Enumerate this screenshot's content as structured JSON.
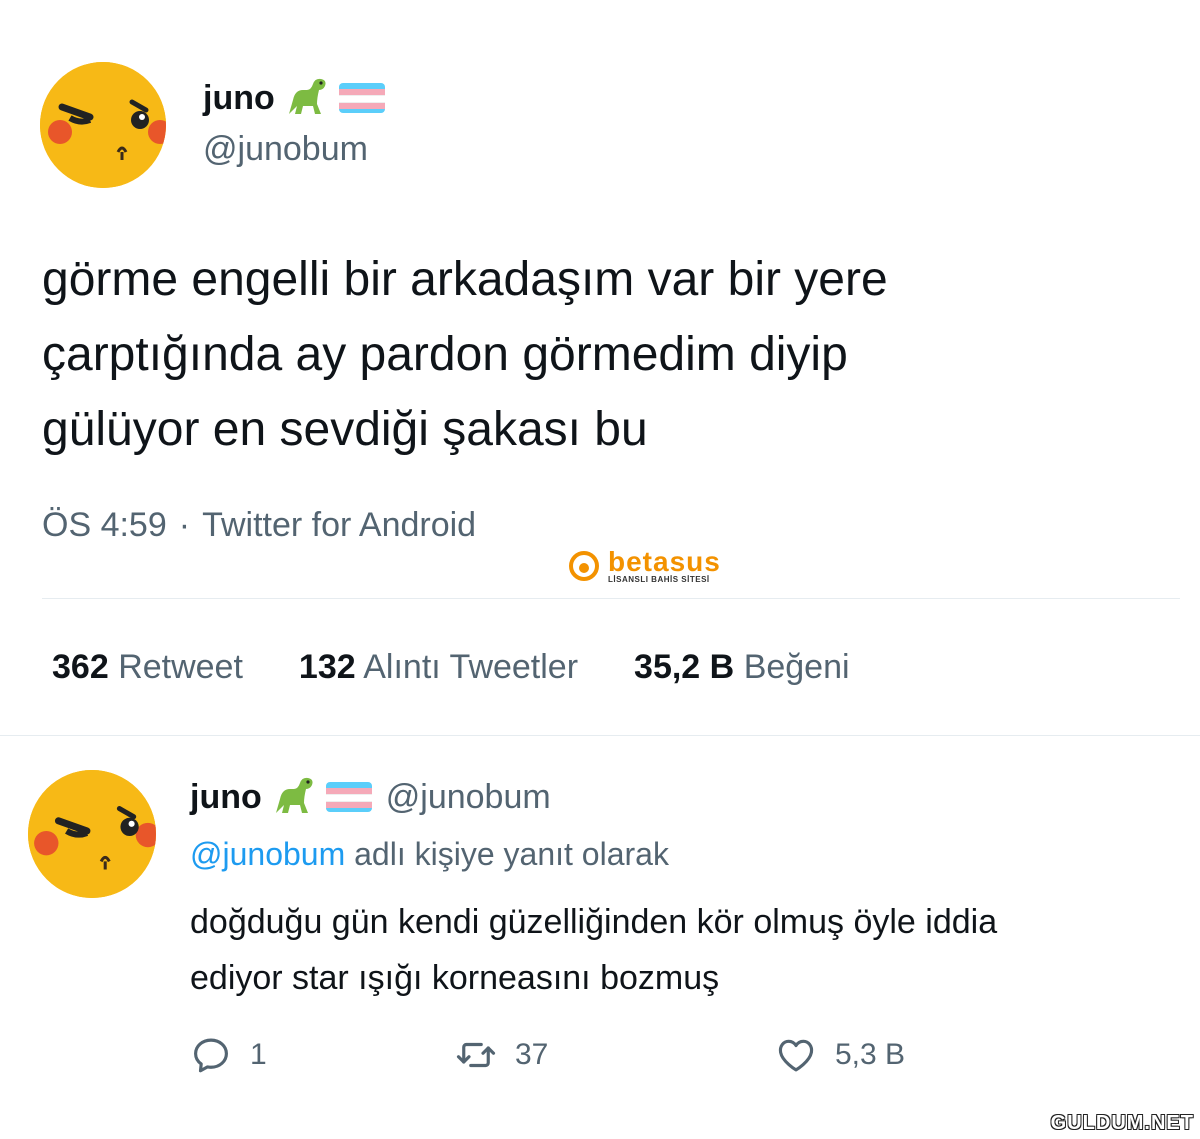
{
  "main_tweet": {
    "display_name": "juno",
    "handle": "@junobum",
    "text_lines": [
      "görme engelli bir arkadaşım var bir yere",
      "çarptığında ay pardon görmedim diyip",
      "gülüyor en sevdiği şakası bu"
    ],
    "time": "ÖS 4:59",
    "separator": "·",
    "source": "Twitter for Android",
    "stats": {
      "retweets_count": "362",
      "retweets_label": "Retweet",
      "quotes_count": "132",
      "quotes_label": "Alıntı Tweetler",
      "likes_count": "35,2 B",
      "likes_label": "Beğeni"
    }
  },
  "reply": {
    "display_name": "juno",
    "handle": "@junobum",
    "reply_to_handle": "@junobum",
    "reply_to_suffix": "adlı kişiye yanıt olarak",
    "text_lines": [
      "doğduğu gün kendi güzelliğinden kör olmuş öyle iddia",
      "ediyor star ışığı korneasını bozmuş"
    ],
    "actions": {
      "reply_count": "1",
      "retweet_count": "37",
      "like_count": "5,3 B"
    }
  },
  "watermarks": {
    "brand_top": "betasus",
    "brand_sub": "LİSANSLI BAHİS SİTESİ",
    "corner": "GULDUM.NET"
  },
  "colors": {
    "text": "#0f1419",
    "muted": "#536471",
    "link": "#1d9bf0",
    "avatar": "#f7b916",
    "flag_blue": "#5bcefa",
    "flag_pink": "#f5a9b8",
    "brand_orange": "#f39200"
  },
  "icons": [
    "dinosaur-icon",
    "trans-flag-icon",
    "reply-icon",
    "retweet-icon",
    "like-icon"
  ]
}
